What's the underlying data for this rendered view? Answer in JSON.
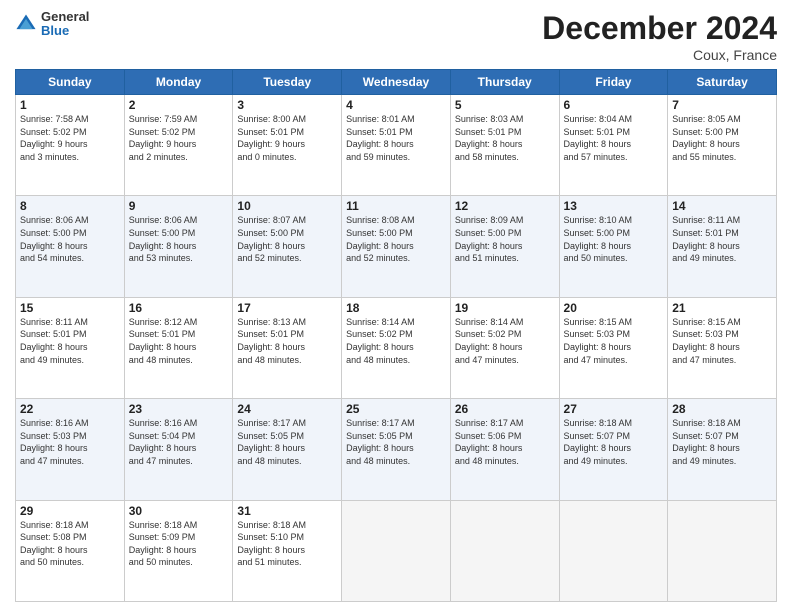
{
  "header": {
    "logo_general": "General",
    "logo_blue": "Blue",
    "title": "December 2024",
    "subtitle": "Coux, France"
  },
  "days_of_week": [
    "Sunday",
    "Monday",
    "Tuesday",
    "Wednesday",
    "Thursday",
    "Friday",
    "Saturday"
  ],
  "weeks": [
    [
      {
        "num": "1",
        "rise": "7:58 AM",
        "set": "5:02 PM",
        "daylight": "9 hours and 3 minutes."
      },
      {
        "num": "2",
        "rise": "7:59 AM",
        "set": "5:02 PM",
        "daylight": "9 hours and 2 minutes."
      },
      {
        "num": "3",
        "rise": "8:00 AM",
        "set": "5:01 PM",
        "daylight": "9 hours and 0 minutes."
      },
      {
        "num": "4",
        "rise": "8:01 AM",
        "set": "5:01 PM",
        "daylight": "8 hours and 59 minutes."
      },
      {
        "num": "5",
        "rise": "8:03 AM",
        "set": "5:01 PM",
        "daylight": "8 hours and 58 minutes."
      },
      {
        "num": "6",
        "rise": "8:04 AM",
        "set": "5:01 PM",
        "daylight": "8 hours and 57 minutes."
      },
      {
        "num": "7",
        "rise": "8:05 AM",
        "set": "5:00 PM",
        "daylight": "8 hours and 55 minutes."
      }
    ],
    [
      {
        "num": "8",
        "rise": "8:06 AM",
        "set": "5:00 PM",
        "daylight": "8 hours and 54 minutes."
      },
      {
        "num": "9",
        "rise": "8:06 AM",
        "set": "5:00 PM",
        "daylight": "8 hours and 53 minutes."
      },
      {
        "num": "10",
        "rise": "8:07 AM",
        "set": "5:00 PM",
        "daylight": "8 hours and 52 minutes."
      },
      {
        "num": "11",
        "rise": "8:08 AM",
        "set": "5:00 PM",
        "daylight": "8 hours and 52 minutes."
      },
      {
        "num": "12",
        "rise": "8:09 AM",
        "set": "5:00 PM",
        "daylight": "8 hours and 51 minutes."
      },
      {
        "num": "13",
        "rise": "8:10 AM",
        "set": "5:00 PM",
        "daylight": "8 hours and 50 minutes."
      },
      {
        "num": "14",
        "rise": "8:11 AM",
        "set": "5:01 PM",
        "daylight": "8 hours and 49 minutes."
      }
    ],
    [
      {
        "num": "15",
        "rise": "8:11 AM",
        "set": "5:01 PM",
        "daylight": "8 hours and 49 minutes."
      },
      {
        "num": "16",
        "rise": "8:12 AM",
        "set": "5:01 PM",
        "daylight": "8 hours and 48 minutes."
      },
      {
        "num": "17",
        "rise": "8:13 AM",
        "set": "5:01 PM",
        "daylight": "8 hours and 48 minutes."
      },
      {
        "num": "18",
        "rise": "8:14 AM",
        "set": "5:02 PM",
        "daylight": "8 hours and 48 minutes."
      },
      {
        "num": "19",
        "rise": "8:14 AM",
        "set": "5:02 PM",
        "daylight": "8 hours and 47 minutes."
      },
      {
        "num": "20",
        "rise": "8:15 AM",
        "set": "5:03 PM",
        "daylight": "8 hours and 47 minutes."
      },
      {
        "num": "21",
        "rise": "8:15 AM",
        "set": "5:03 PM",
        "daylight": "8 hours and 47 minutes."
      }
    ],
    [
      {
        "num": "22",
        "rise": "8:16 AM",
        "set": "5:03 PM",
        "daylight": "8 hours and 47 minutes."
      },
      {
        "num": "23",
        "rise": "8:16 AM",
        "set": "5:04 PM",
        "daylight": "8 hours and 47 minutes."
      },
      {
        "num": "24",
        "rise": "8:17 AM",
        "set": "5:05 PM",
        "daylight": "8 hours and 48 minutes."
      },
      {
        "num": "25",
        "rise": "8:17 AM",
        "set": "5:05 PM",
        "daylight": "8 hours and 48 minutes."
      },
      {
        "num": "26",
        "rise": "8:17 AM",
        "set": "5:06 PM",
        "daylight": "8 hours and 48 minutes."
      },
      {
        "num": "27",
        "rise": "8:18 AM",
        "set": "5:07 PM",
        "daylight": "8 hours and 49 minutes."
      },
      {
        "num": "28",
        "rise": "8:18 AM",
        "set": "5:07 PM",
        "daylight": "8 hours and 49 minutes."
      }
    ],
    [
      {
        "num": "29",
        "rise": "8:18 AM",
        "set": "5:08 PM",
        "daylight": "8 hours and 50 minutes."
      },
      {
        "num": "30",
        "rise": "8:18 AM",
        "set": "5:09 PM",
        "daylight": "8 hours and 50 minutes."
      },
      {
        "num": "31",
        "rise": "8:18 AM",
        "set": "5:10 PM",
        "daylight": "8 hours and 51 minutes."
      },
      null,
      null,
      null,
      null
    ]
  ]
}
